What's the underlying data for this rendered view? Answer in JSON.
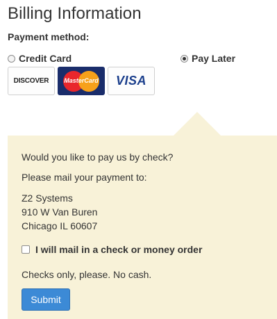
{
  "title": "Billing Information",
  "payment": {
    "label": "Payment method:",
    "options": [
      {
        "label": "Credit Card",
        "selected": false
      },
      {
        "label": "Pay Later",
        "selected": true
      }
    ]
  },
  "cards": {
    "discover": "DISCOVER",
    "mastercard": "MasterCard",
    "visa": "VISA"
  },
  "pay_later": {
    "question": "Would you like to pay us by check?",
    "mail_to": "Please mail your payment to:",
    "address": [
      "Z2 Systems",
      "910 W Van Buren",
      "Chicago IL 60607"
    ],
    "checkbox_label": "I will mail in a check or money order",
    "checkbox_checked": false,
    "note": "Checks only, please. No cash.",
    "submit_label": "Submit"
  },
  "colors": {
    "panel_bg": "#f8f2d8",
    "submit_bg": "#3c8ad6",
    "mastercard_bg": "#1a2d6b",
    "visa_text": "#1a3e8c"
  }
}
